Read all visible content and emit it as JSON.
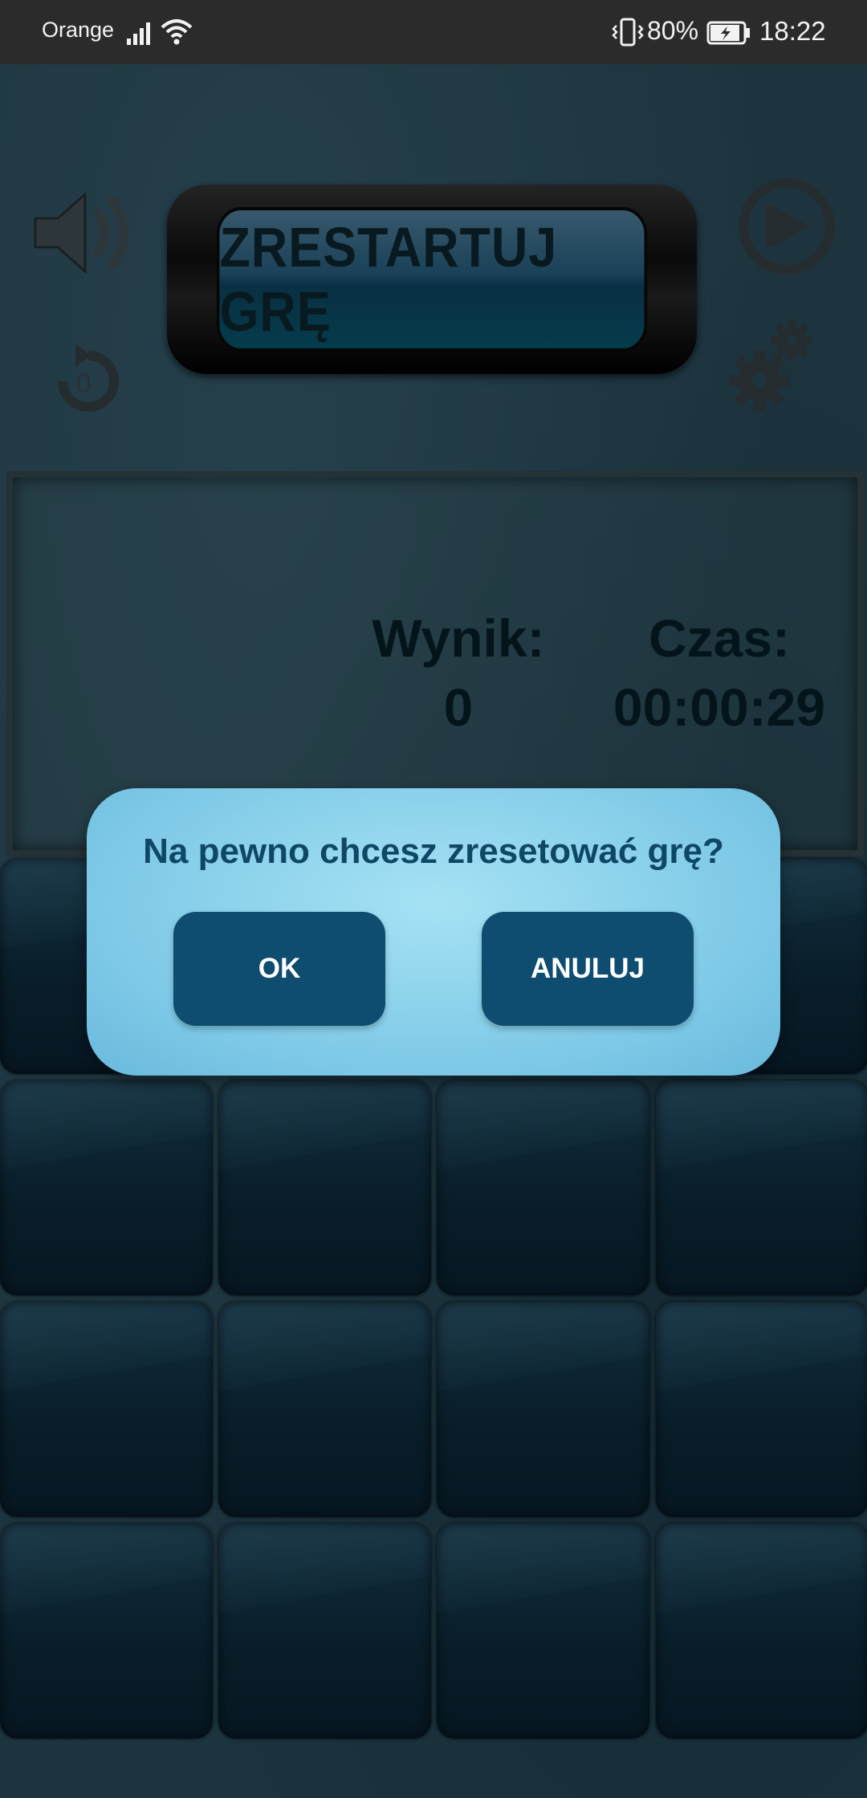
{
  "status_bar": {
    "carrier": "Orange",
    "battery_percent": "80%",
    "time": "18:22",
    "icons": [
      "signal-icon",
      "wifi-icon",
      "vibrate-icon",
      "battery-charging-icon"
    ]
  },
  "game": {
    "restart_button_label": "ZRESTARTUJ GRĘ",
    "restart_counter": "0",
    "score": {
      "label": "Wynik:",
      "value": "0"
    },
    "time": {
      "label": "Czas:",
      "value": "00:00:29"
    },
    "icons": [
      "sound-icon",
      "restart-counter-icon",
      "play-icon",
      "settings-icon"
    ]
  },
  "dialog": {
    "message": "Na pewno chcesz zresetować grę?",
    "ok_label": "OK",
    "cancel_label": "ANULUJ"
  },
  "colors": {
    "dialog_bg": "#7cc8e6",
    "dialog_button": "#0e4d70",
    "dialog_text": "#0f4766",
    "board_bg": "#2f5566"
  }
}
